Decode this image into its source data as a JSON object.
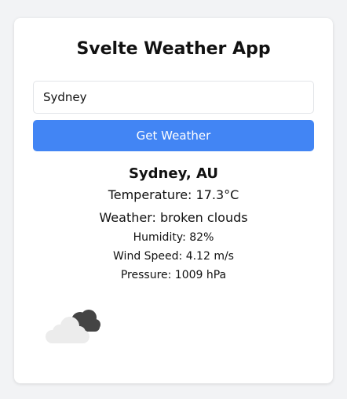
{
  "app": {
    "title": "Svelte Weather App"
  },
  "search": {
    "value": "Sydney",
    "button_label": "Get Weather"
  },
  "weather": {
    "location": "Sydney, AU",
    "temperature": "Temperature: 17.3°C",
    "description": "Weather: broken clouds",
    "humidity": "Humidity: 82%",
    "wind": "Wind Speed: 4.12 m/s",
    "pressure": "Pressure: 1009 hPa",
    "icon": "broken-clouds-icon"
  },
  "colors": {
    "accent": "#4285f4",
    "background": "#f2f3f5",
    "card": "#ffffff"
  }
}
